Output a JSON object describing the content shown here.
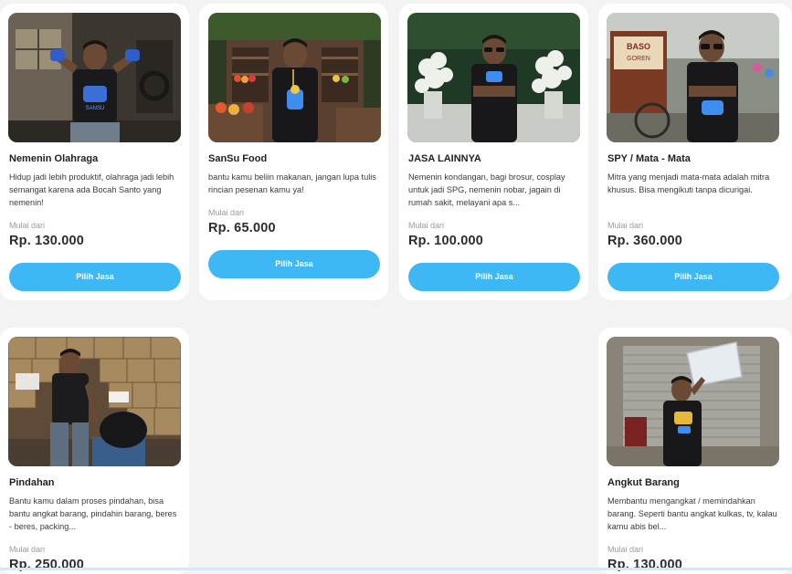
{
  "services": [
    {
      "title": "Nemenin Olahraga",
      "description": "Hidup jadi lebih produktif, olahraga jadi lebih semangat karena ada Bocah Santo yang nemenin!",
      "from_label": "Mulai dari",
      "price": "Rp. 130.000",
      "button_label": "Pilih Jasa"
    },
    {
      "title": "SanSu Food",
      "description": "bantu kamu beliin makanan, jangan lupa tulis rincian pesenan kamu ya!",
      "from_label": "Mulai dari",
      "price": "Rp. 65.000",
      "button_label": "Pilih Jasa"
    },
    {
      "title": "JASA LAINNYA",
      "description": "Nemenin kondangan, bagi brosur, cosplay untuk jadi SPG, nemenin nobar, jagain di rumah sakit, melayani apa s...",
      "from_label": "Mulai dari",
      "price": "Rp. 100.000",
      "button_label": "Pilih Jasa"
    },
    {
      "title": "SPY / Mata - Mata",
      "description": "Mitra yang menjadi mata-mata adalah mitra khusus. Bisa mengikuti tanpa dicurigai.",
      "from_label": "Mulai dari",
      "price": "Rp. 360.000",
      "button_label": "Pilih Jasa"
    },
    {
      "title": "Pindahan",
      "description": "Bantu kamu dalam proses pindahan, bisa bantu angkat barang, pindahin barang, beres - beres, packing...",
      "from_label": "Mulai dari",
      "price": "Rp. 250.000"
    },
    {
      "title": "Angkut Barang",
      "description": "Membantu mengangkat / memindahkan barang. Seperti bantu angkat kulkas, tv, kalau kamu abis bel...",
      "from_label": "Mulai dari",
      "price": "Rp. 130.000"
    }
  ],
  "photo_text": {
    "stall_sign": "BASO",
    "stall_sign_2": "GOREN",
    "shirt_brand": "SANSU"
  },
  "colors": {
    "accent": "#3db8f5",
    "card_bg": "#ffffff",
    "page_bg": "#f3f3f4",
    "price_text": "#2b2d33"
  }
}
